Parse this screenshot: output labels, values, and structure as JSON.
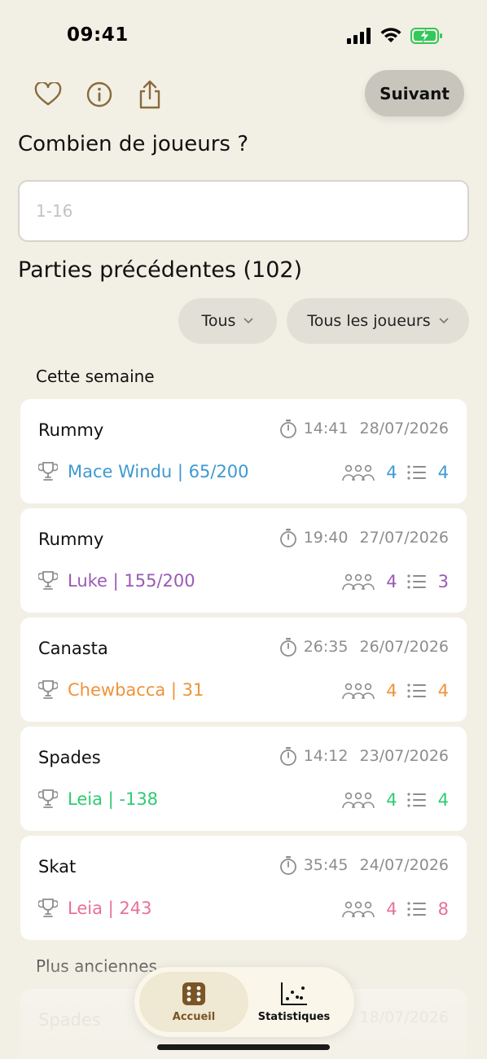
{
  "status": {
    "time": "09:41"
  },
  "toolbar": {
    "next_label": "Suivant"
  },
  "question": "Combien de joueurs ?",
  "players_input": {
    "placeholder": "1-16",
    "value": ""
  },
  "history": {
    "title": "Parties précédentes (102)",
    "filters": {
      "type_label": "Tous",
      "players_label": "Tous les joueurs"
    },
    "groups": [
      {
        "label": "Cette semaine"
      },
      {
        "label": "Plus anciennes"
      }
    ],
    "games": [
      {
        "name": "Rummy",
        "duration": "14:41",
        "date": "28/07/2026",
        "winner": "Mace Windu | 65/200",
        "players": "4",
        "rounds": "4",
        "color": "#3d9ad1"
      },
      {
        "name": "Rummy",
        "duration": "19:40",
        "date": "27/07/2026",
        "winner": "Luke | 155/200",
        "players": "4",
        "rounds": "3",
        "color": "#9b59b6"
      },
      {
        "name": "Canasta",
        "duration": "26:35",
        "date": "26/07/2026",
        "winner": "Chewbacca | 31",
        "players": "4",
        "rounds": "4",
        "color": "#f0923a"
      },
      {
        "name": "Spades",
        "duration": "14:12",
        "date": "23/07/2026",
        "winner": "Leia | -138",
        "players": "4",
        "rounds": "4",
        "color": "#2ecc71"
      },
      {
        "name": "Skat",
        "duration": "35:45",
        "date": "24/07/2026",
        "winner": "Leia | 243",
        "players": "4",
        "rounds": "8",
        "color": "#e8709a"
      }
    ],
    "older_games": [
      {
        "name": "Spades",
        "date": "18/07/2026"
      }
    ]
  },
  "tabbar": {
    "home_label": "Accueil",
    "stats_label": "Statistiques"
  },
  "colors": {
    "background": "#f2efe5",
    "accent_brown": "#7a5525",
    "icon_brown": "#8a6a3c",
    "battery_green": "#34c759"
  }
}
